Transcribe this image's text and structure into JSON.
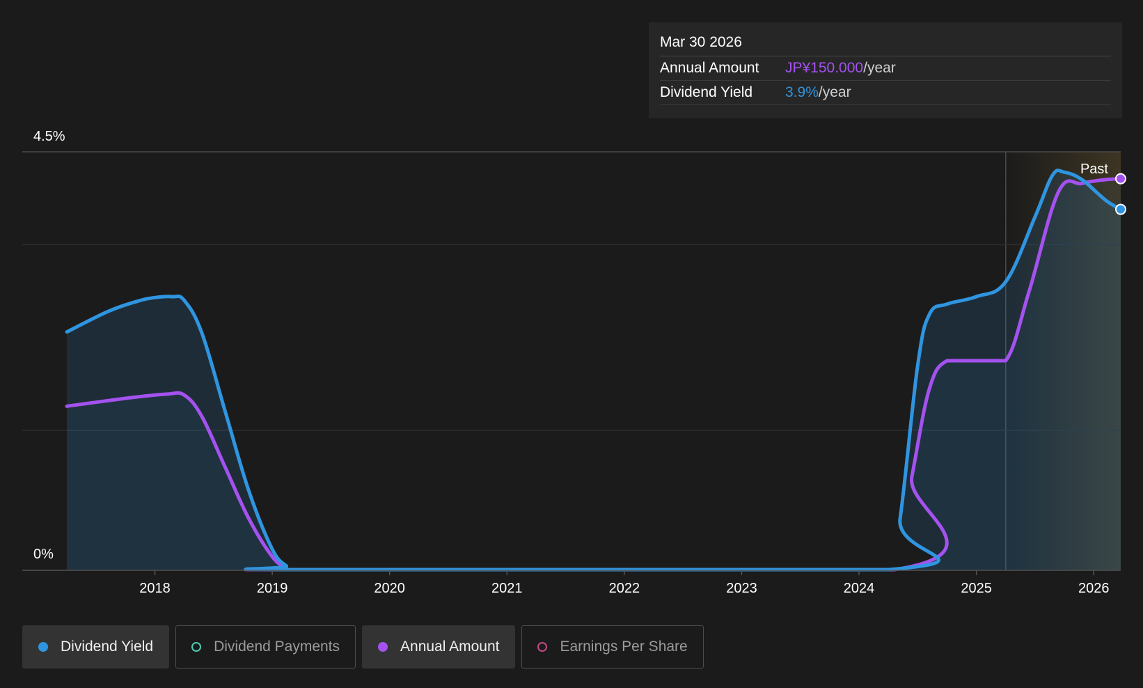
{
  "colors": {
    "background": "#1b1b1b",
    "dividend_yield": "#2f95e0",
    "annual_amount": "#a452ef",
    "dividend_payments": "#4fc9b4",
    "earnings_per_share": "#c34b86",
    "forecast_shade": "#5a4a28"
  },
  "tooltip": {
    "date": "Mar 30 2026",
    "rows": [
      {
        "label": "Annual Amount",
        "value": "JP¥150.000",
        "unit": "/year",
        "color": "#a452ef"
      },
      {
        "label": "Dividend Yield",
        "value": "3.9%",
        "unit": "/year",
        "color": "#2f95e0"
      }
    ]
  },
  "legend": [
    {
      "label": "Dividend Yield",
      "active": true,
      "color": "#2f95e0",
      "icon": "filled-circle-icon"
    },
    {
      "label": "Dividend Payments",
      "active": false,
      "color": "#4fc9b4",
      "icon": "hollow-circle-icon"
    },
    {
      "label": "Annual Amount",
      "active": true,
      "color": "#a452ef",
      "icon": "filled-circle-icon"
    },
    {
      "label": "Earnings Per Share",
      "active": false,
      "color": "#c34b86",
      "icon": "hollow-circle-icon"
    }
  ],
  "chart_data": {
    "type": "area",
    "title": "",
    "xlabel": "",
    "ylabel": "",
    "ylim": [
      0,
      4.5
    ],
    "xlim": [
      2016.87,
      2026.23
    ],
    "y_tick_labels": [
      {
        "value": 4.5,
        "label": "4.5%"
      },
      {
        "value": 0,
        "label": "0%"
      }
    ],
    "x_ticks": [
      2018,
      2019,
      2020,
      2021,
      2022,
      2023,
      2024,
      2025,
      2026
    ],
    "grid": true,
    "past_region_start": 2025.25,
    "past_label": "Past",
    "series": [
      {
        "name": "Dividend Yield",
        "unit": "%",
        "points": [
          [
            2017.25,
            2.56
          ],
          [
            2017.6,
            2.78
          ],
          [
            2017.85,
            2.89
          ],
          [
            2018.0,
            2.93
          ],
          [
            2018.15,
            2.94
          ],
          [
            2018.25,
            2.9
          ],
          [
            2018.4,
            2.55
          ],
          [
            2018.6,
            1.7
          ],
          [
            2018.8,
            0.85
          ],
          [
            2019.0,
            0.22
          ],
          [
            2019.12,
            0.04
          ],
          [
            2019.2,
            0.0
          ],
          [
            2024.25,
            0.0
          ],
          [
            2024.35,
            0.55
          ],
          [
            2024.5,
            2.2
          ],
          [
            2024.6,
            2.75
          ],
          [
            2024.75,
            2.86
          ],
          [
            2025.0,
            2.94
          ],
          [
            2025.25,
            3.1
          ],
          [
            2025.5,
            3.8
          ],
          [
            2025.65,
            4.25
          ],
          [
            2025.75,
            4.28
          ],
          [
            2025.9,
            4.2
          ],
          [
            2026.1,
            3.98
          ],
          [
            2026.23,
            3.88
          ]
        ]
      },
      {
        "name": "Annual Amount",
        "unit": "JP¥",
        "points": [
          [
            2017.25,
            1.76
          ],
          [
            2017.6,
            1.82
          ],
          [
            2017.85,
            1.86
          ],
          [
            2018.1,
            1.89
          ],
          [
            2018.25,
            1.88
          ],
          [
            2018.4,
            1.65
          ],
          [
            2018.6,
            1.1
          ],
          [
            2018.8,
            0.55
          ],
          [
            2019.0,
            0.14
          ],
          [
            2019.12,
            0.02
          ],
          [
            2019.2,
            0.0
          ],
          [
            2024.3,
            0.0
          ],
          [
            2024.45,
            1.0
          ],
          [
            2024.6,
            1.95
          ],
          [
            2024.75,
            2.25
          ],
          [
            2025.0,
            2.25
          ],
          [
            2025.25,
            2.25
          ],
          [
            2025.45,
            3.0
          ],
          [
            2025.7,
            4.07
          ],
          [
            2025.9,
            4.16
          ],
          [
            2026.1,
            4.2
          ],
          [
            2026.23,
            4.21
          ]
        ]
      }
    ]
  }
}
